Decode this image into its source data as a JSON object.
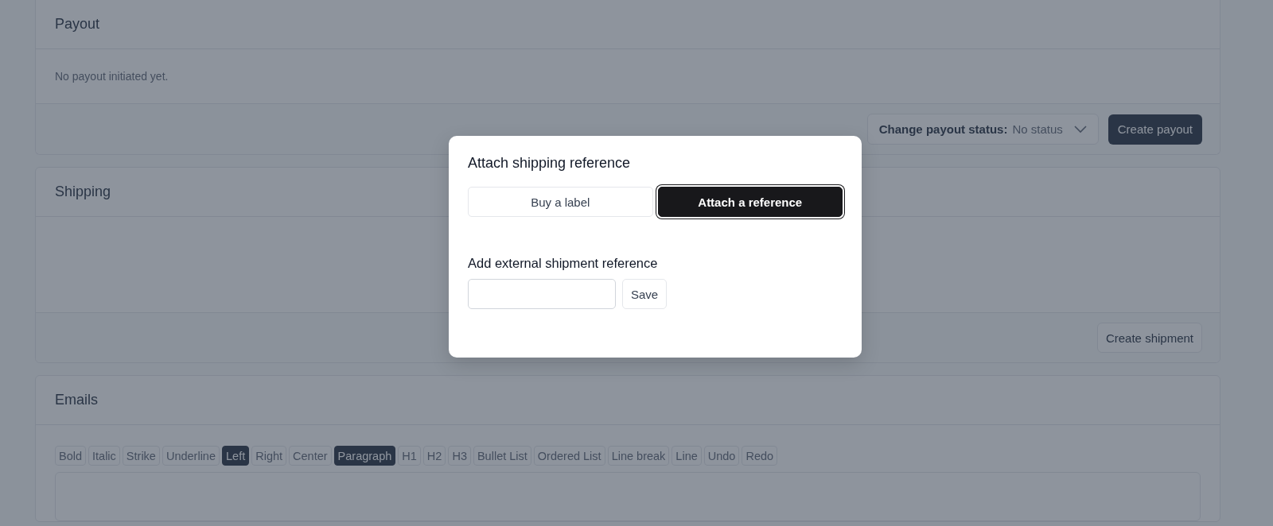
{
  "payout": {
    "title": "Payout",
    "message": "No payout initiated yet.",
    "status_select": {
      "label": "Change payout status:",
      "value": "No status"
    },
    "create_button": "Create payout"
  },
  "shipping": {
    "title": "Shipping",
    "create_button": "Create shipment"
  },
  "emails": {
    "title": "Emails",
    "toolbar": [
      {
        "label": "Bold",
        "selected": false
      },
      {
        "label": "Italic",
        "selected": false
      },
      {
        "label": "Strike",
        "selected": false
      },
      {
        "label": "Underline",
        "selected": false
      },
      {
        "label": "Left",
        "selected": true
      },
      {
        "label": "Right",
        "selected": false
      },
      {
        "label": "Center",
        "selected": false
      },
      {
        "label": "Paragraph",
        "selected": true
      },
      {
        "label": "H1",
        "selected": false
      },
      {
        "label": "H2",
        "selected": false
      },
      {
        "label": "H3",
        "selected": false
      },
      {
        "label": "Bullet List",
        "selected": false
      },
      {
        "label": "Ordered List",
        "selected": false
      },
      {
        "label": "Line break",
        "selected": false
      },
      {
        "label": "Line",
        "selected": false
      },
      {
        "label": "Undo",
        "selected": false
      },
      {
        "label": "Redo",
        "selected": false
      }
    ]
  },
  "dialog": {
    "title": "Attach shipping reference",
    "tabs": [
      {
        "label": "Buy a label",
        "selected": false
      },
      {
        "label": "Attach a reference",
        "selected": true
      }
    ],
    "field_label": "Add external shipment reference",
    "save_button": "Save"
  }
}
